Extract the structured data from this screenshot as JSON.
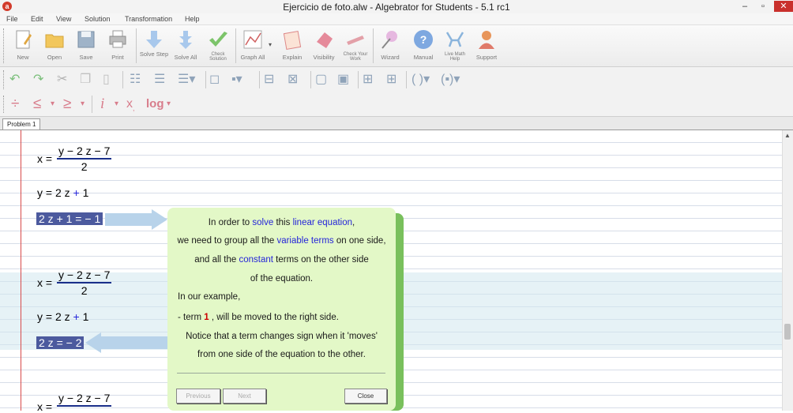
{
  "window": {
    "title": "Ejercicio de foto.alw - Algebrator for Students - 5.1 rc1",
    "minimize": "–",
    "maximize": "▫",
    "close": "✕"
  },
  "menu": [
    "File",
    "Edit",
    "View",
    "Solution",
    "Transformation",
    "Help"
  ],
  "toolbar": {
    "buttons": [
      {
        "label": "New",
        "icon": "new-document-icon"
      },
      {
        "label": "Open",
        "icon": "folder-icon"
      },
      {
        "label": "Save",
        "icon": "floppy-icon"
      },
      {
        "label": "Print",
        "icon": "printer-icon"
      },
      {
        "label": "Solve Step",
        "icon": "arrow-down-icon"
      },
      {
        "label": "Solve All",
        "icon": "double-arrow-down-icon"
      },
      {
        "label": "Check Solution",
        "icon": "checkmark-icon"
      },
      {
        "label": "Graph All",
        "icon": "graph-icon"
      },
      {
        "label": "Explain",
        "icon": "explain-icon"
      },
      {
        "label": "Visibility",
        "icon": "eraser-icon"
      },
      {
        "label": "Check Your Work",
        "icon": "pencil-check-icon"
      },
      {
        "label": "Wizard",
        "icon": "wizard-wand-icon"
      },
      {
        "label": "Manual",
        "icon": "help-question-icon"
      },
      {
        "label": "Live Math Help",
        "icon": "live-help-icon"
      },
      {
        "label": "Support",
        "icon": "support-person-icon"
      }
    ]
  },
  "insert_toolbar": {
    "log": "log"
  },
  "tabs": [
    {
      "label": "Problem 1"
    }
  ],
  "workspace": {
    "eq1": {
      "lhs": "x =",
      "num": "y − 2 z − 7",
      "den": "2"
    },
    "eq2": {
      "a": "y = 2 z ",
      "plus": "+",
      "b": " 1"
    },
    "eq3": "2 z + 1 = − 1",
    "eq4": {
      "lhs": "x =",
      "num": "y − 2 z − 7",
      "den": "2"
    },
    "eq5": {
      "a": "y = 2 z ",
      "plus": "+",
      "b": " 1"
    },
    "eq6": "2 z = − 2",
    "eq7": {
      "lhs": "x =",
      "num": "y − 2 z − 7"
    }
  },
  "popup": {
    "l1": {
      "a": "In order to ",
      "solve": "solve",
      "b": " this ",
      "lin": "linear equation",
      "c": ","
    },
    "l2": {
      "a": "we need to group all the ",
      "var": "variable terms",
      "b": " on one side,"
    },
    "l3": {
      "a": "and all the ",
      "con": "constant",
      "b": " terms on the other side"
    },
    "l4": "of the equation.",
    "l5": "In our example,",
    "l6": {
      "a": "- term  ",
      "term": "1",
      "b": "  , will be moved to the right side."
    },
    "l7": "Notice that a term changes sign when it 'moves'",
    "l8": "from one side of the equation to the other.",
    "previous": "Previous",
    "next": "Next",
    "close": "Close"
  },
  "colors": {
    "accent_blue": "#2424d9",
    "highlight": "#4c5a9e",
    "popup_bg": "#e3f8c7",
    "margin_red": "#d84a4a"
  }
}
